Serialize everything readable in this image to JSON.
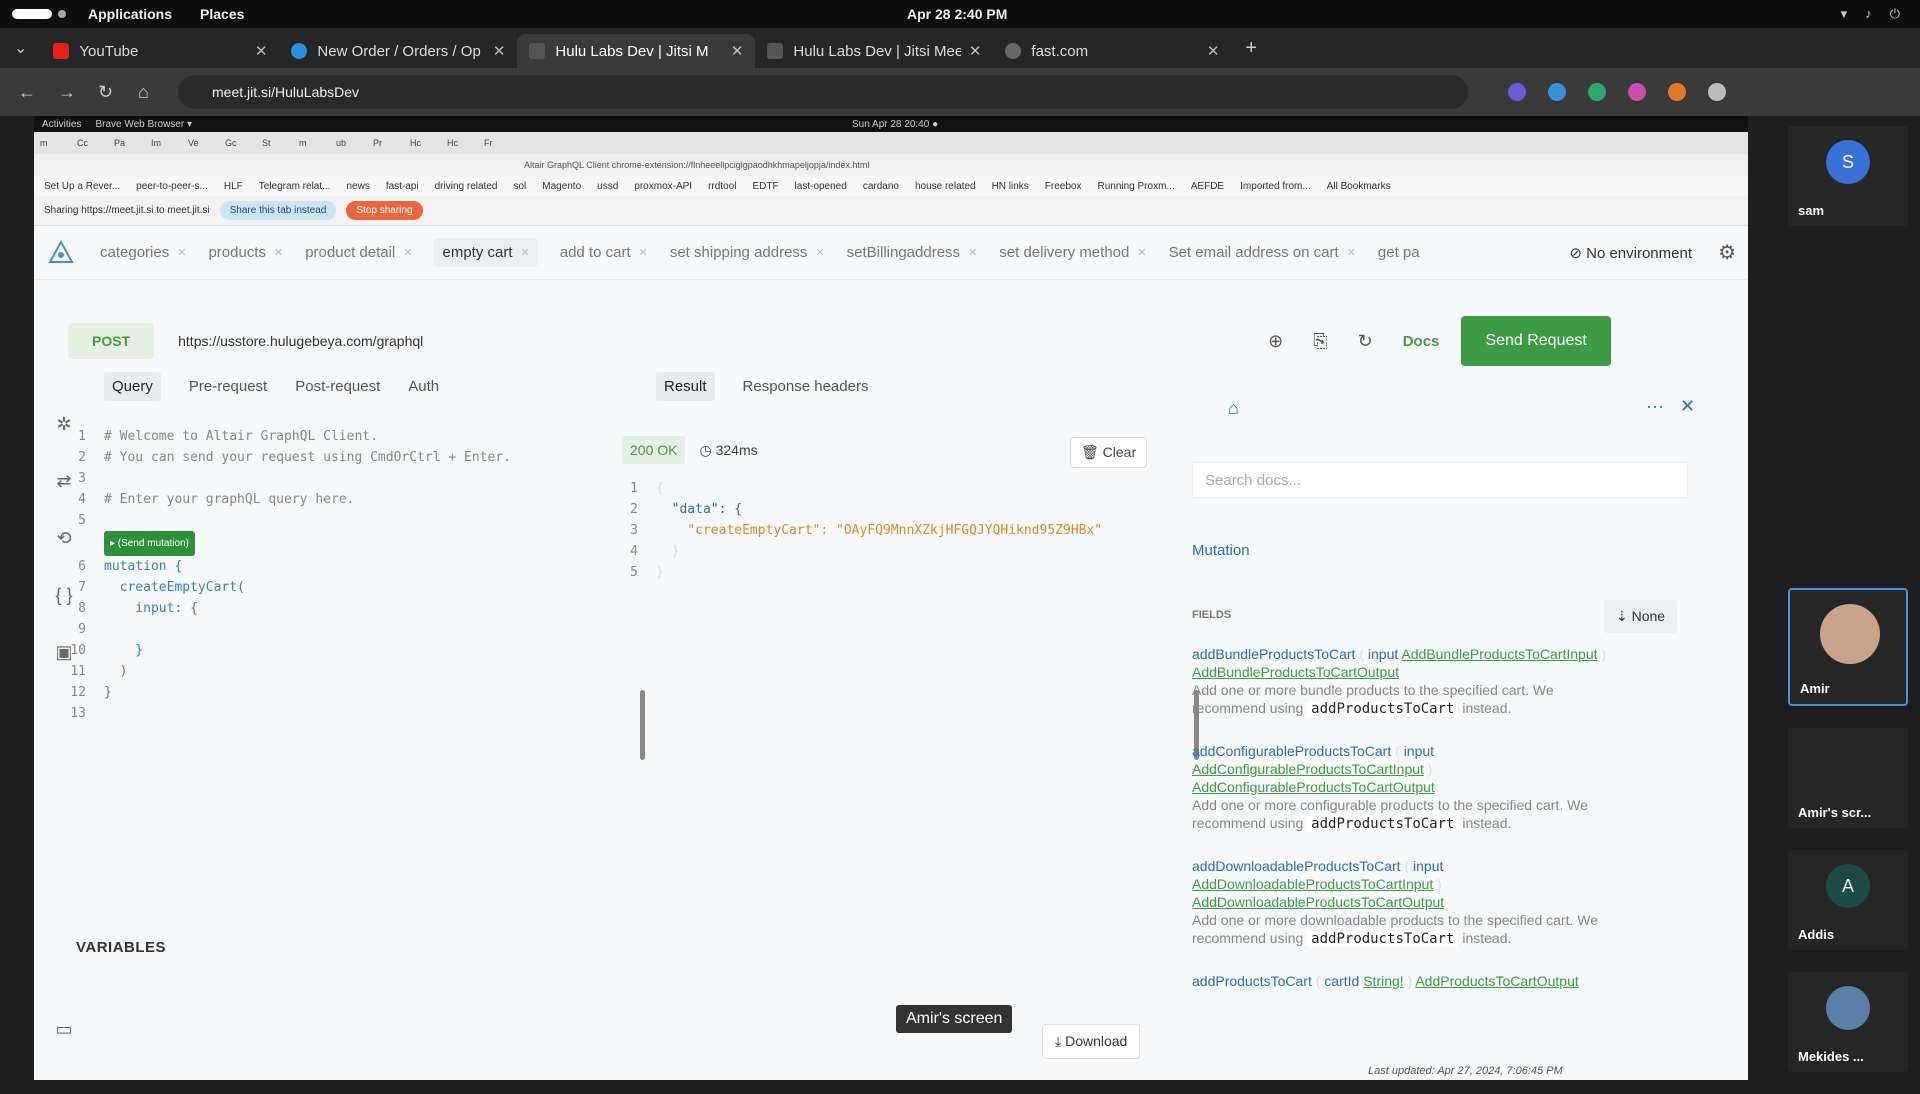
{
  "system_bar": {
    "menu_items": [
      "Applications",
      "Places"
    ],
    "clock": "Apr 28  2:40 PM"
  },
  "browser": {
    "tabs": [
      {
        "title": "YouTube",
        "color": "#e62117"
      },
      {
        "title": "New Order / Orders / Op",
        "color": "#2b8fe0"
      },
      {
        "title": "Hulu Labs Dev | Jitsi M",
        "color": "#9aa0a6"
      },
      {
        "title": "Hulu Labs Dev | Jitsi Meet",
        "color": "#9aa0a6"
      },
      {
        "title": "fast.com",
        "color": "#9aa0a6"
      }
    ],
    "url": "meet.jit.si/HuluLabsDev"
  },
  "shared_screen": {
    "gnome_activities": "Activities",
    "gnome_browser": "Brave Web Browser ▾",
    "gnome_clock": "Sun Apr 28  20:40 ●",
    "inner_url": "Altair GraphQL Client    chrome-extension://flnheeellpciglgpaodhkhmapeljopja/index.html",
    "bookmarks": [
      "Set Up a Rever...",
      "peer-to-peer-s...",
      "HLF",
      "Telegram relat...",
      "news",
      "fast-api",
      "driving related",
      "sol",
      "Magento",
      "ussd",
      "proxmox-API",
      "rrdtool",
      "EDTF",
      "last-opened",
      "cardano",
      "house related",
      "HN links",
      "Freebox",
      "Running Proxm...",
      "AEFDE",
      "Imported from...",
      "All Bookmarks"
    ],
    "sharing_text": "Sharing https://meet.jit.si to meet.jit.si",
    "share_tab_label": "Share this tab instead",
    "stop_sharing_label": "Stop sharing"
  },
  "altair": {
    "query_tabs": [
      "categories",
      "products",
      "product detail",
      "empty cart",
      "add to cart",
      "set shipping address",
      "setBillingaddress",
      "set delivery method",
      "Set email address on cart",
      "get pa"
    ],
    "environment": "No environment",
    "method": "POST",
    "endpoint": "https://usstore.hulugebeya.com/graphql",
    "docs_label": "Docs",
    "send_label": "Send Request",
    "left_tabs": [
      "Query",
      "Pre-request",
      "Post-request",
      "Auth"
    ],
    "send_mutation_label": "▸ (Send mutation)",
    "query_lines": [
      "# Welcome to Altair GraphQL Client.",
      "# You can send your request using CmdOrCtrl + Enter.",
      "",
      "# Enter your graphQL query here.",
      "",
      "mutation {",
      "  createEmptyCart(",
      "    input: {",
      "",
      "    }",
      "  )",
      "}",
      ""
    ],
    "variables_label": "VARIABLES",
    "result_tabs": [
      "Result",
      "Response headers"
    ],
    "status": "200 OK",
    "duration": "324ms",
    "clear_label": "Clear",
    "result_lines": [
      "{",
      "  \"data\": {",
      "    \"createEmptyCart\": \"OAyFQ9MnnXZkjHFGQJYQHiknd95Z9HBx\"",
      "  }",
      "}"
    ],
    "download_label": "Download",
    "docs_panel": {
      "search_placeholder": "Search docs...",
      "root": "Mutation",
      "fields_label": "FIELDS",
      "sort_label": "None",
      "fields": [
        {
          "name": "addBundleProductsToCart",
          "arg": "input",
          "arg_type": "AddBundleProductsToCartInput",
          "return_type": "AddBundleProductsToCartOutput",
          "desc": "Add one or more bundle products to the specified cart. We recommend using",
          "code": "addProductsToCart",
          "desc_end": "instead."
        },
        {
          "name": "addConfigurableProductsToCart",
          "arg": "input",
          "arg_type": "AddConfigurableProductsToCartInput",
          "return_type": "AddConfigurableProductsToCartOutput",
          "desc": "Add one or more configurable products to the specified cart. We recommend using",
          "code": "addProductsToCart",
          "desc_end": "instead."
        },
        {
          "name": "addDownloadableProductsToCart",
          "arg": "input",
          "arg_type": "AddDownloadableProductsToCartInput",
          "return_type": "AddDownloadableProductsToCartOutput",
          "desc": "Add one or more downloadable products to the specified cart. We recommend using",
          "code": "addProductsToCart",
          "desc_end": "instead."
        },
        {
          "name": "addProductsToCart",
          "arg": "cartId",
          "arg_type": "String!",
          "return_type": "AddProductsToCartOutput",
          "desc": "",
          "code": "",
          "desc_end": ""
        }
      ],
      "last_updated": "Last updated: Apr 27, 2024, 7:06:45 PM"
    }
  },
  "screen_caption": "Amir's screen",
  "participants": [
    {
      "name": "sam",
      "initial": "S",
      "color": "#3a6fd8"
    },
    {
      "name": "Amir",
      "initial": "",
      "color": "#c9a48a"
    },
    {
      "name": "Amir's scr...",
      "initial": "",
      "color": "#333333"
    },
    {
      "name": "Addis",
      "initial": "A",
      "color": "#1d4a47"
    },
    {
      "name": "Mekides ...",
      "initial": "",
      "color": "#5a7fa8"
    }
  ]
}
